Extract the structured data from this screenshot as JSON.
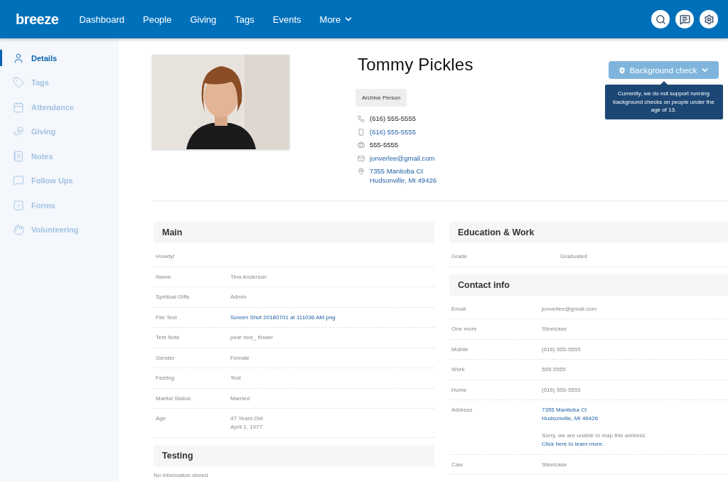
{
  "header": {
    "logo": "breeze",
    "nav": [
      {
        "label": "Dashboard",
        "dropdown": false
      },
      {
        "label": "People",
        "dropdown": false
      },
      {
        "label": "Giving",
        "dropdown": false
      },
      {
        "label": "Tags",
        "dropdown": false
      },
      {
        "label": "Events",
        "dropdown": false
      },
      {
        "label": "More",
        "dropdown": true
      }
    ],
    "actions": [
      {
        "kind": "search"
      },
      {
        "kind": "messages"
      },
      {
        "kind": "settings"
      }
    ]
  },
  "sidebar": {
    "items": [
      {
        "label": "Details",
        "selected": true
      },
      {
        "label": "Tags",
        "selected": false
      },
      {
        "label": "Attendance",
        "selected": false
      },
      {
        "label": "Giving",
        "selected": false
      },
      {
        "label": "Notes",
        "selected": false
      },
      {
        "label": "Follow Ups",
        "selected": false
      },
      {
        "label": "Forms",
        "selected": false
      },
      {
        "label": "Volunteering",
        "selected": false
      }
    ]
  },
  "profile": {
    "name": "Tommy Pickles",
    "archive_button": "Archive Person",
    "contacts": [
      {
        "kind": "phone",
        "link": false,
        "lines": [
          "(616) 555-5555"
        ]
      },
      {
        "kind": "mobile",
        "link": true,
        "lines": [
          "(616) 555-5555"
        ]
      },
      {
        "kind": "work",
        "link": false,
        "lines": [
          "555-5555"
        ]
      },
      {
        "kind": "email",
        "link": true,
        "lines": [
          "jonverlee@gmail.com"
        ]
      },
      {
        "kind": "address",
        "link": true,
        "lines": [
          "7355 Manitoba Ct",
          "Hudsonville, MI 49426"
        ]
      }
    ],
    "background_check": {
      "label": "Background check",
      "tooltip": "Currently, we do not support running background checks on people under the age of 13."
    }
  },
  "left_sections": [
    {
      "title": "Main",
      "rows": [
        {
          "label": "Howdy!"
        },
        {
          "label": "Name",
          "values": [
            {
              "text": "Tina Anderson",
              "link": false
            }
          ]
        },
        {
          "label": "Spiritual Gifts",
          "values": [
            {
              "text": "Admin",
              "link": false
            }
          ]
        },
        {
          "label": "File Test",
          "values": [
            {
              "text": "Screen Shot 20180701 at 111036 AM.png",
              "link": true
            }
          ]
        },
        {
          "label": "Test Note",
          "values": [
            {
              "text": "pear tree_ flower",
              "link": false
            }
          ]
        },
        {
          "label": "Gender",
          "values": [
            {
              "text": "Female",
              "link": false
            }
          ]
        },
        {
          "label": "Feeling",
          "values": [
            {
              "text": "Test",
              "link": false
            }
          ]
        },
        {
          "label": "Marital Status",
          "values": [
            {
              "text": "Married",
              "link": false
            }
          ]
        },
        {
          "label": "Age",
          "values": [
            {
              "text": "47 Years Old",
              "link": false
            },
            {
              "text": "April 1, 1977",
              "link": false
            }
          ]
        }
      ]
    },
    {
      "title": "Testing",
      "empty": "No information stored"
    }
  ],
  "right_sections": [
    {
      "title": "Education & Work",
      "rows": [
        {
          "label": "Grade",
          "values": [
            {
              "text": "Graduated",
              "link": false
            }
          ]
        }
      ]
    },
    {
      "title": "Contact info",
      "rows": [
        {
          "label": "Email",
          "values": [
            {
              "text": "jonverlee@gmail.com",
              "link": false
            }
          ]
        },
        {
          "label": "One more",
          "values": [
            {
              "text": "Steelcase",
              "link": false
            }
          ]
        },
        {
          "label": "Mobile",
          "values": [
            {
              "text": "(616) 555-5555",
              "link": false
            }
          ]
        },
        {
          "label": "Work",
          "values": [
            {
              "text": "555-5555",
              "link": false
            }
          ]
        },
        {
          "label": "Home",
          "values": [
            {
              "text": "(616) 555-5555",
              "link": false
            }
          ]
        },
        {
          "label": "Address",
          "values": [
            {
              "text": "7355 Manitoba Ct",
              "link": true
            },
            {
              "text": "Hudsonville, MI 49426",
              "link": true
            }
          ],
          "note": "Sorry, we are unable to map this address.",
          "note_link": "Click here to learn more."
        },
        {
          "label": "Caw",
          "values": [
            {
              "text": "Steelcase",
              "link": false
            }
          ]
        }
      ]
    }
  ]
}
